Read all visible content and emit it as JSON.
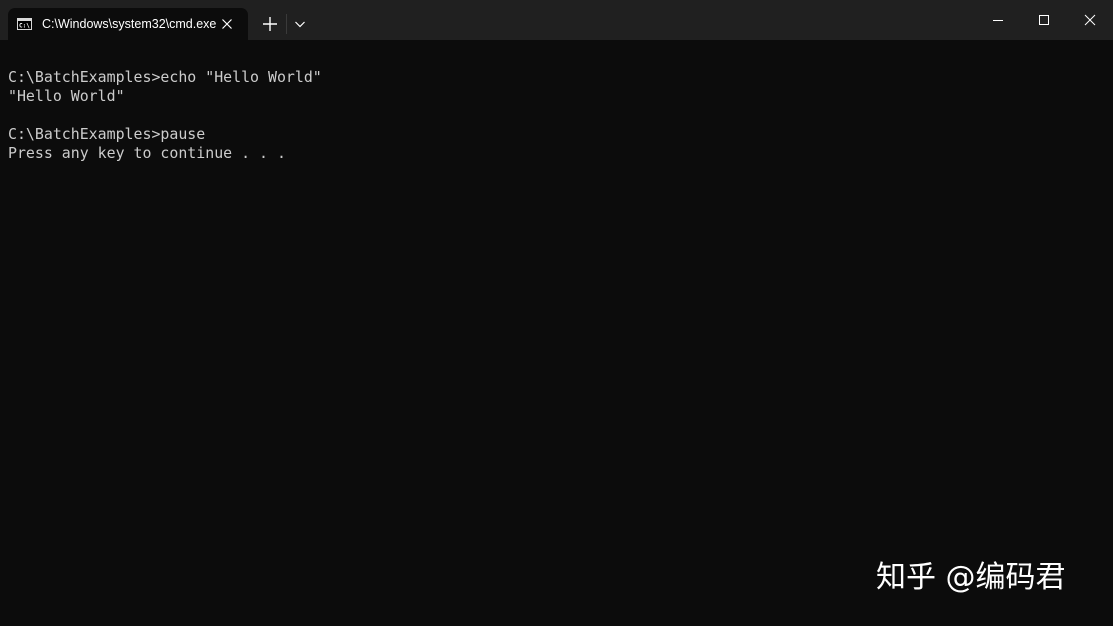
{
  "window": {
    "tab_title": "C:\\Windows\\system32\\cmd.exe"
  },
  "icons": {
    "tab": "cmd-icon",
    "tab_close": "close-icon",
    "new_tab": "plus-icon",
    "dropdown": "chevron-down-icon",
    "minimize": "minimize-icon",
    "maximize": "maximize-icon",
    "close_window": "close-icon"
  },
  "colors": {
    "background": "#0c0c0c",
    "titlebar": "#202020",
    "text": "#cccccc"
  },
  "terminal": {
    "lines": [
      "C:\\BatchExamples>echo \"Hello World\"",
      "\"Hello World\"",
      "",
      "C:\\BatchExamples>pause",
      "Press any key to continue . . ."
    ]
  },
  "watermark": "知乎 @编码君"
}
